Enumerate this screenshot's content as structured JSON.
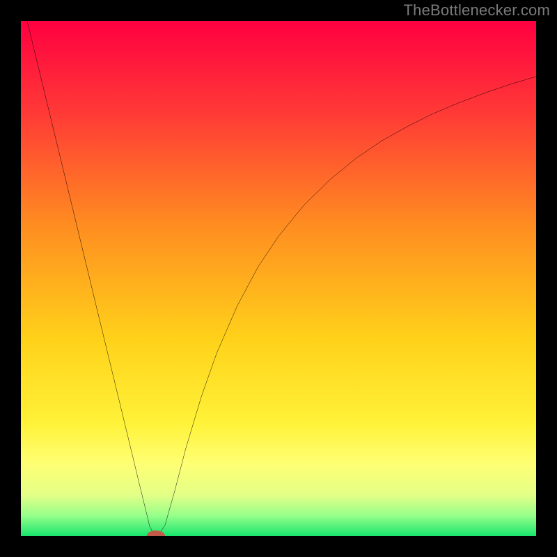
{
  "watermark": "TheBottlenecker.com",
  "chart_data": {
    "type": "line",
    "title": "",
    "xlabel": "",
    "ylabel": "",
    "xlim": [
      0,
      100
    ],
    "ylim": [
      0,
      100
    ],
    "grid": false,
    "background_gradient": {
      "direction": "vertical",
      "stops": [
        {
          "pos": 0.0,
          "color": "#ff0041"
        },
        {
          "pos": 0.18,
          "color": "#ff3a36"
        },
        {
          "pos": 0.4,
          "color": "#ff8e20"
        },
        {
          "pos": 0.62,
          "color": "#ffd21a"
        },
        {
          "pos": 0.78,
          "color": "#fff238"
        },
        {
          "pos": 0.86,
          "color": "#ffff74"
        },
        {
          "pos": 0.92,
          "color": "#e3ff86"
        },
        {
          "pos": 0.96,
          "color": "#97ff8a"
        },
        {
          "pos": 1.0,
          "color": "#18e56e"
        }
      ]
    },
    "series": [
      {
        "name": "curve",
        "color": "#000000",
        "x": [
          0,
          5,
          10,
          15,
          20,
          23,
          24,
          25,
          26,
          27,
          28,
          30,
          32,
          35,
          38,
          42,
          46,
          50,
          55,
          60,
          65,
          70,
          75,
          80,
          85,
          90,
          95,
          100
        ],
        "y": [
          105,
          84.4,
          63.8,
          43.1,
          22.5,
          10.1,
          6.0,
          1.9,
          0.0,
          0.6,
          2.2,
          9.3,
          17.0,
          27.0,
          35.5,
          44.7,
          52.2,
          58.2,
          64.3,
          69.2,
          73.3,
          76.7,
          79.5,
          82.0,
          84.1,
          86.0,
          87.7,
          89.2
        ]
      }
    ],
    "marker": {
      "name": "min-marker",
      "x": 26.2,
      "y": 0.0,
      "rx": 1.8,
      "ry": 1.1,
      "color": "#c25a4a"
    }
  }
}
